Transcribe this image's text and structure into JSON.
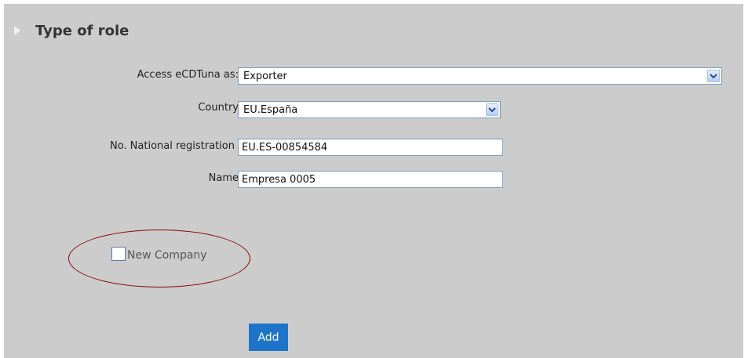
{
  "section": {
    "title": "Type of role"
  },
  "form": {
    "access_label": "Access eCDTuna as:",
    "access_value": "Exporter",
    "country_label": "Country",
    "country_value": "EU.España",
    "registration_label": "No. National registration",
    "registration_value": "EU.ES-00854584",
    "name_label": "Name",
    "name_value": "Empresa 0005",
    "new_company_label": "New Company",
    "new_company_checked": false,
    "add_label": "Add"
  },
  "colors": {
    "panel_bg": "#cccccc",
    "input_border": "#7f9db9",
    "highlight_ellipse": "#8b0000",
    "add_button_bg": "#1e74c9"
  },
  "icons": {
    "section": "triangle-right-icon",
    "dropdown": "chevron-down-icon"
  }
}
